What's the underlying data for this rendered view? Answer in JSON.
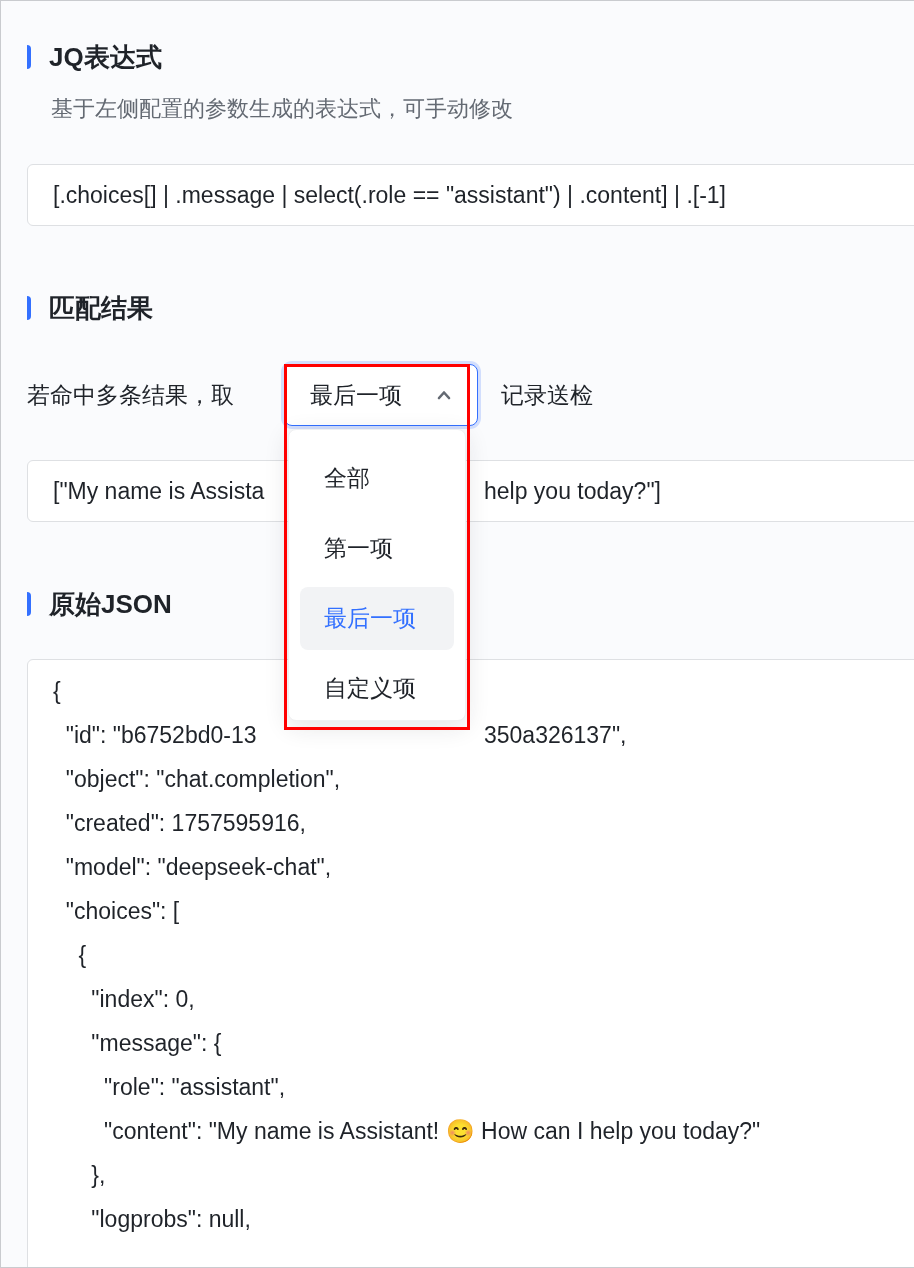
{
  "jq_section": {
    "title": "JQ表达式",
    "subtitle": "基于左侧配置的参数生成的表达式，可手动修改",
    "expression": "[.choices[] | .message | select(.role == \"assistant\") | .content] | .[-1]"
  },
  "match_section": {
    "title": "匹配结果",
    "prefix_label": "若命中多条结果，取",
    "select": {
      "value": "最后一项",
      "expanded": true,
      "options": [
        {
          "label": "全部",
          "selected": false
        },
        {
          "label": "第一项",
          "selected": false
        },
        {
          "label": "最后一项",
          "selected": true
        },
        {
          "label": "自定义项",
          "selected": false
        }
      ]
    },
    "suffix_label": "记录送检",
    "result": {
      "text": "[\"My name is Assista",
      "text_end": "help you today?\"]"
    }
  },
  "raw_section": {
    "title": "原始JSON",
    "lines": [
      {
        "text": "{"
      },
      {
        "text": "  \"id\": \"b6752bd0-13",
        "text_end": "350a326137\","
      },
      {
        "text": "  \"object\": \"chat.completion\","
      },
      {
        "text": "  \"created\": 1757595916,"
      },
      {
        "text": "  \"model\": \"deepseek-chat\","
      },
      {
        "text": "  \"choices\": ["
      },
      {
        "text": "    {"
      },
      {
        "text": "      \"index\": 0,"
      },
      {
        "text": "      \"message\": {"
      },
      {
        "text": "        \"role\": \"assistant\","
      },
      {
        "text": "        \"content\": \"My name is Assistant! 😊 How can I help you today?\""
      },
      {
        "text": "      },"
      },
      {
        "text": "      \"logprobs\": null,"
      }
    ]
  },
  "highlight_frame": true
}
